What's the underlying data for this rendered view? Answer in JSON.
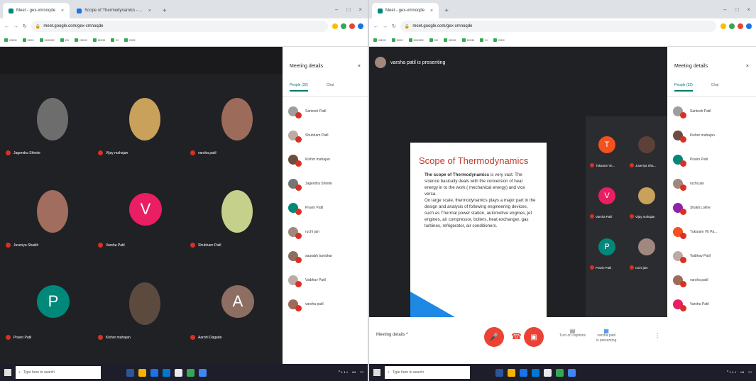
{
  "left": {
    "tabs": [
      {
        "label": "Meet - gex-xmnoqde",
        "active": true
      },
      {
        "label": "Scope of Thermodynamics - ...",
        "active": false
      }
    ],
    "url": "meet.google.com/gex-xmnoqde",
    "participants_grid": [
      {
        "name": "Jagendra Shinde",
        "kind": "photo",
        "color": "#6d6d6d"
      },
      {
        "name": "Vijay mahajan",
        "kind": "photo",
        "color": "#c9a15a"
      },
      {
        "name": "varsha patil",
        "kind": "photo",
        "color": "#9c6b5a"
      },
      {
        "name": "Juveriya Shaikh",
        "kind": "photo",
        "color": "#a06d5e"
      },
      {
        "name": "Varsha Patil",
        "kind": "letter",
        "letter": "V",
        "color": "#e91e63"
      },
      {
        "name": "Shubham Patil",
        "kind": "photo",
        "color": "#c5d08a"
      },
      {
        "name": "Pravin Patil",
        "kind": "letter",
        "letter": "P",
        "color": "#00897b"
      },
      {
        "name": "Kishor mahajan",
        "kind": "photo",
        "color": "#5d4a3e"
      },
      {
        "name": "Aarohi Dagade",
        "kind": "letter",
        "letter": "A",
        "color": "#8d6e63"
      }
    ],
    "side": {
      "title": "Meeting details",
      "close": "×",
      "tab_people": "People (32)",
      "tab_chat": "Chat",
      "people": [
        {
          "name": "Santosh Patil",
          "color": "#9e9e9e"
        },
        {
          "name": "Shubham Patil",
          "color": "#bcaaa4"
        },
        {
          "name": "Kishor mahajan",
          "color": "#6d4c41"
        },
        {
          "name": "Jagendra Shinde",
          "color": "#757575"
        },
        {
          "name": "Pravin Patil",
          "color": "#00897b"
        },
        {
          "name": "ruchi jain",
          "color": "#a1887f"
        },
        {
          "name": "saurabh baviskar",
          "color": "#8d6e63"
        },
        {
          "name": "Vaibhav Patil",
          "color": "#bcaaa4"
        },
        {
          "name": "varsha patil",
          "color": "#9c6b5a"
        }
      ]
    }
  },
  "right": {
    "tabs": [
      {
        "label": "Meet - gex-xmnoqde",
        "active": true
      }
    ],
    "url": "meet.google.com/gex-xmnoqde",
    "presenter": "varsha patil is presenting",
    "slide": {
      "title": "Scope of Thermodynamics",
      "para1_bold": "The scope of Thermodynamics",
      "para1_rest": " is very vast. The science basically deals with the conversion of heat energy in to the work ( mechanical energy) and vice versa.",
      "para2": "On large scale, thermodynamics plays a major part in the design and analysis of following engineering devices, such as Thermal power station, automotive engines, jet engines, air compressor, boilers, heat exchanger, gas turbines, refrigerator, air conditioners."
    },
    "strip": [
      {
        "name": "Tukaram Vit...",
        "kind": "letter",
        "letter": "T",
        "color": "#f4511e"
      },
      {
        "name": "Juveriya Sha...",
        "kind": "photo",
        "color": "#5d4037"
      },
      {
        "name": "Varsha Patil",
        "kind": "letter",
        "letter": "V",
        "color": "#e91e63"
      },
      {
        "name": "Vijay mahajan",
        "kind": "photo",
        "color": "#c9a15a"
      },
      {
        "name": "Pravin Patil",
        "kind": "letter",
        "letter": "P",
        "color": "#00897b"
      },
      {
        "name": "ruchi jain",
        "kind": "photo",
        "color": "#a1887f"
      }
    ],
    "controls": {
      "details": "Meeting details",
      "details_arrow": "^",
      "captions_line1": "Turn on captions",
      "presenting_line1": "varsha patil",
      "presenting_line2": "is presenting"
    },
    "side": {
      "title": "Meeting details",
      "close": "×",
      "tab_people": "People (32)",
      "tab_chat": "Chat",
      "people": [
        {
          "name": "Santosh Patil",
          "color": "#9e9e9e"
        },
        {
          "name": "Kishor mahajan",
          "color": "#6d4c41"
        },
        {
          "name": "Pravin Patil",
          "color": "#00897b"
        },
        {
          "name": "ruchi jain",
          "color": "#a1887f"
        },
        {
          "name": "Shakti Lokhe",
          "color": "#8e24aa"
        },
        {
          "name": "Tukaram Vit Pa...",
          "color": "#f4511e"
        },
        {
          "name": "Vaibhav Patil",
          "color": "#bcaaa4"
        },
        {
          "name": "varsha patil",
          "color": "#9c6b5a"
        },
        {
          "name": "Varsha Patil",
          "color": "#e91e63"
        }
      ]
    }
  },
  "taskbar": {
    "search_placeholder": "Type here to search"
  }
}
